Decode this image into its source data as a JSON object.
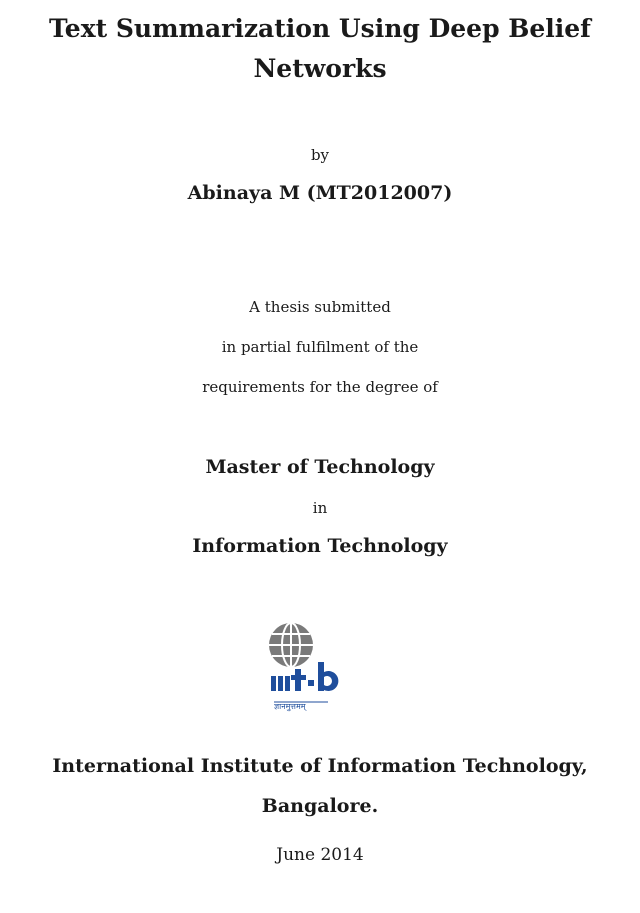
{
  "title_line1": "Text Summarization Using Deep Belief",
  "title_line2": "Networks",
  "by": "by",
  "author": "Abinaya M (MT2012007)",
  "thesis_line1": "A thesis submitted",
  "thesis_line2": "in partial fulfilment of the",
  "thesis_line3": "requirements for the degree of",
  "degree": "Master of Technology",
  "in": "in",
  "field": "Information Technology",
  "logo": {
    "icon": "iiit-b-globe-logo",
    "wordmark": "iiit·b",
    "motto": "ज्ञानमुत्तमम्",
    "colors": {
      "globe": "#7a7a7a",
      "wordmark": "#1f4e9c"
    }
  },
  "institution_line1": "International Institute of Information Technology,",
  "institution_line2": "Bangalore.",
  "date": "June 2014"
}
